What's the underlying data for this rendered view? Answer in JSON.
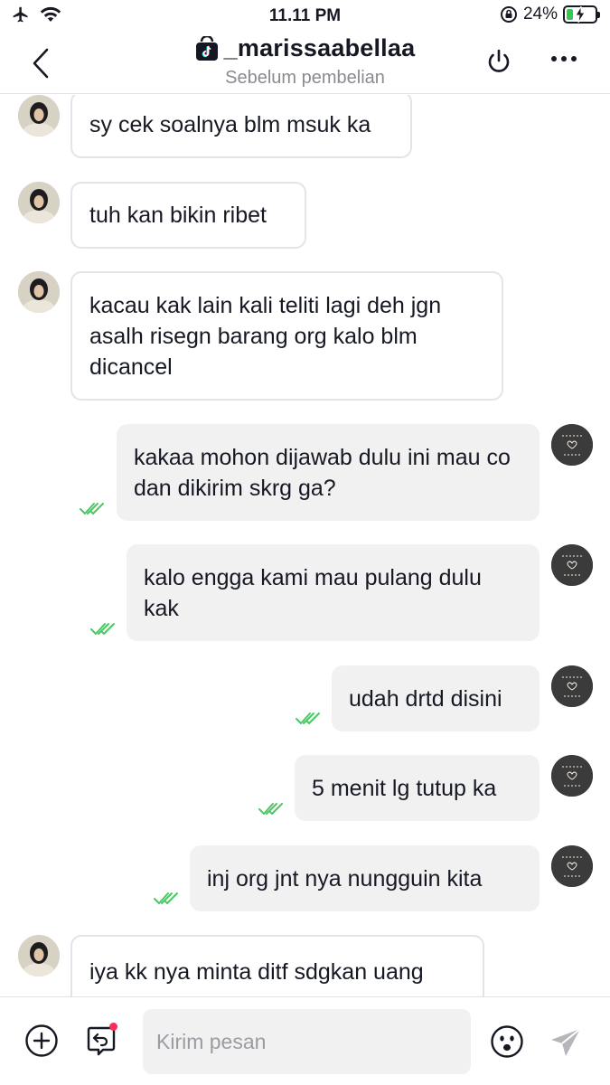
{
  "status_bar": {
    "time": "11.11 PM",
    "battery_percent": "24%",
    "battery_level": 0.24
  },
  "header": {
    "title": "_marissaabellaa",
    "subtitle": "Sebelum pembelian"
  },
  "messages": [
    {
      "side": "in",
      "text": "sy cek soalnya blm msuk ka"
    },
    {
      "side": "in",
      "text": "tuh kan bikin ribet"
    },
    {
      "side": "in",
      "text": "kacau kak lain kali teliti lagi deh jgn asalh risegn barang org kalo blm dicancel"
    },
    {
      "side": "out",
      "text": "kakaa mohon dijawab dulu ini mau co dan dikirim skrg ga?",
      "read": true
    },
    {
      "side": "out",
      "text": "kalo engga kami mau pulang dulu kak",
      "read": true
    },
    {
      "side": "out",
      "text": "udah drtd disini",
      "read": true
    },
    {
      "side": "out",
      "text": "5 menit lg tutup ka",
      "read": true
    },
    {
      "side": "out",
      "text": "inj org jnt nya nungguin kita",
      "read": true
    },
    {
      "side": "in",
      "text": "iya kk nya minta ditf sdgkan uang"
    }
  ],
  "composer": {
    "placeholder": "Kirim pesan"
  },
  "colors": {
    "read_tick": "#4cc764",
    "notification_dot": "#fe2c55",
    "outgoing_bubble": "#f1f1f2",
    "incoming_border": "#e4e4e6"
  },
  "icons": {
    "back": "chevron-left-icon",
    "shop": "tiktok-shop-icon",
    "power": "power-icon",
    "more": "more-icon",
    "plus": "plus-circle-icon",
    "return": "return-icon",
    "emoji": "emoji-icon",
    "send": "send-icon"
  }
}
